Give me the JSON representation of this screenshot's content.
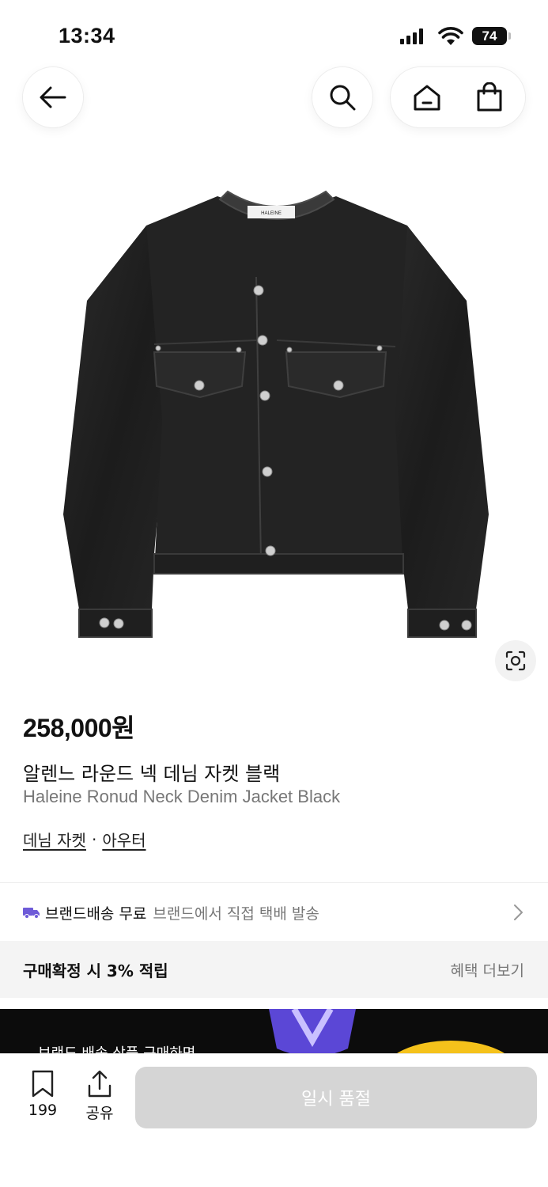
{
  "status_bar": {
    "time": "13:34",
    "battery": "74"
  },
  "nav": {
    "back_icon": "arrow-left-icon",
    "search_icon": "search-icon",
    "home_icon": "home-icon",
    "bag_icon": "shopping-bag-icon"
  },
  "product": {
    "image_label": "HALEINE",
    "price": "258,000원",
    "name_ko": "알렌느 라운드 넥 데님 자켓 블랙",
    "name_en": "Haleine Ronud Neck Denim Jacket Black",
    "category": [
      "데님 자켓",
      "아우터"
    ],
    "category_separator": "·"
  },
  "shipping": {
    "title": "브랜드배송 무료",
    "detail": "브랜드에서 직접 택배 발송"
  },
  "benefit": {
    "title": "구매확정 시 3% 적립",
    "more": "혜택 더보기"
  },
  "promo": {
    "text": "브랜드 배송 상품 구매하면"
  },
  "bottom": {
    "bookmark_count": "199",
    "share_label": "공유",
    "buy_label": "일시 품절"
  },
  "colors": {
    "accent_purple": "#6e5bd8",
    "disabled_button": "#d5d5d5",
    "promo_bg": "#0c0c0c"
  }
}
